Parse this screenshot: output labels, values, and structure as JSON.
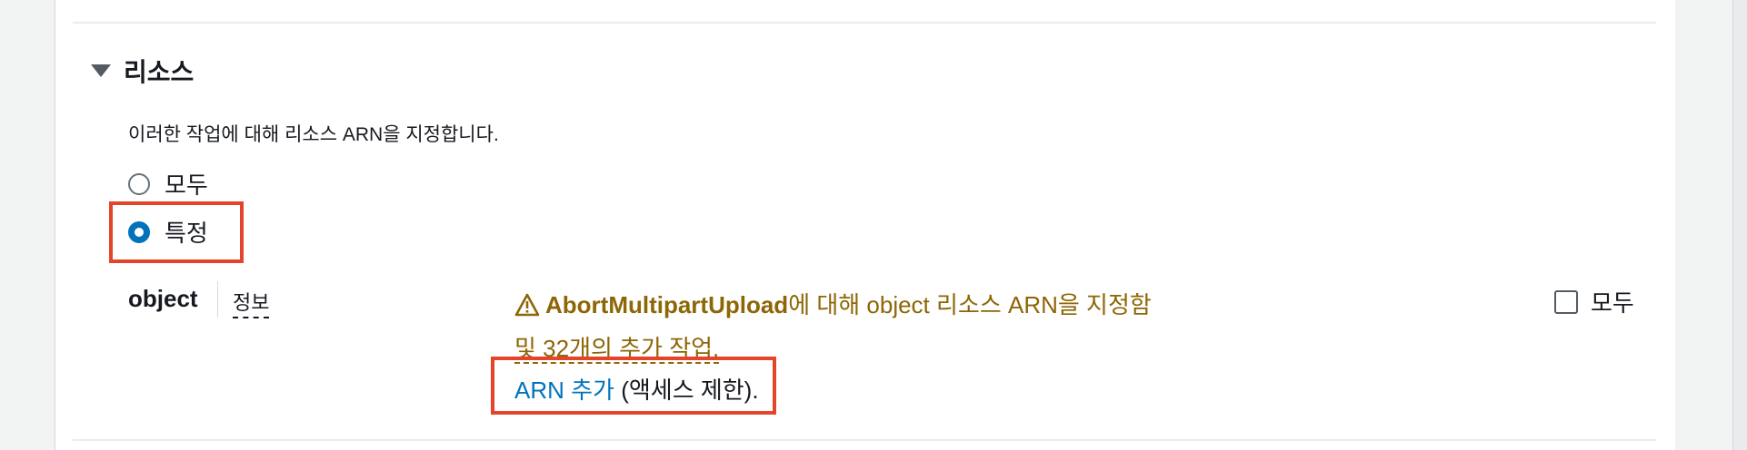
{
  "section": {
    "title": "리소스",
    "description": "이러한 작업에 대해 리소스 ARN을 지정합니다."
  },
  "scope": {
    "options": [
      {
        "label": "모두",
        "selected": false
      },
      {
        "label": "특정",
        "selected": true
      }
    ]
  },
  "resource": {
    "type_label": "object",
    "info_link": "정보",
    "warning": {
      "action": "AbortMultipartUpload",
      "text": "에 대해 object 리소스 ARN을 지정함",
      "more_link": "및 32개의 추가 작업."
    },
    "add_arn_link": "ARN 추가",
    "add_arn_suffix": " (액세스 제한).",
    "all_checkbox_label": "모두",
    "all_checked": false
  },
  "colors": {
    "highlight": "#e4452a",
    "link": "#0073bb",
    "warning": "#8d6605",
    "radio_selected": "#0073bb"
  },
  "icons": {
    "caret": "caret-down-icon",
    "warning": "warning-icon"
  }
}
